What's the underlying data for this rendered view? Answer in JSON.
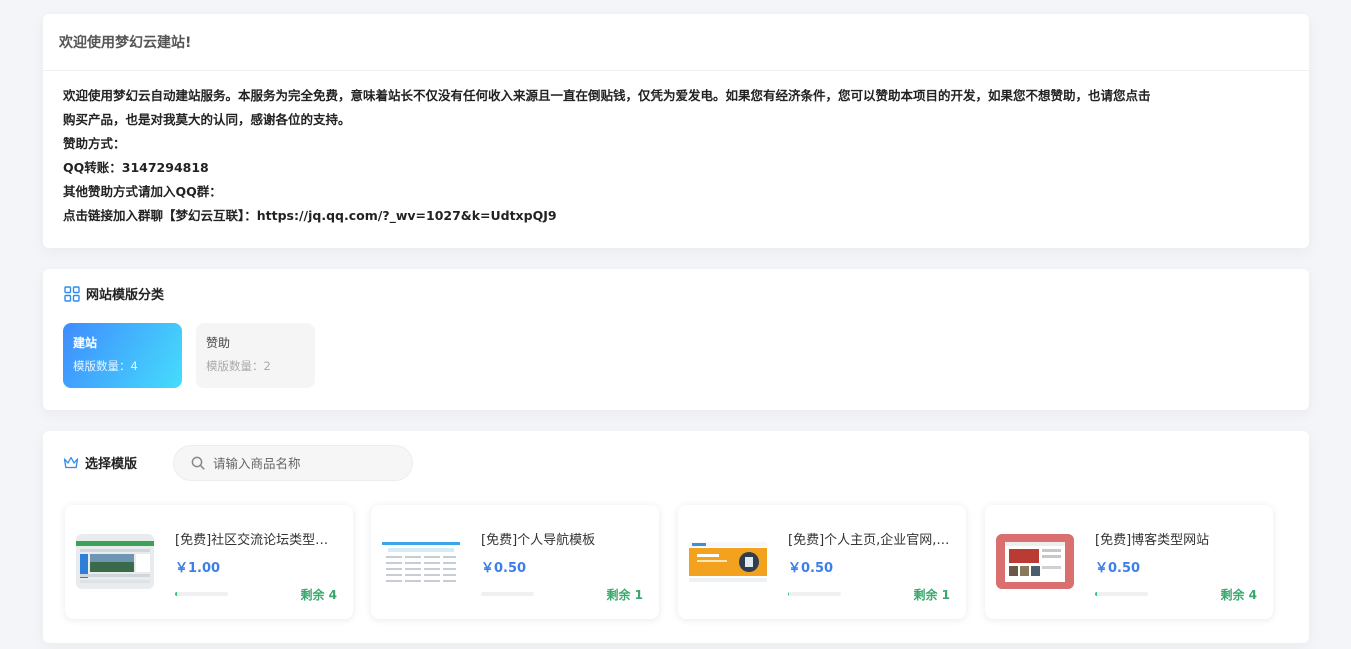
{
  "notice": {
    "title": "欢迎使用梦幻云建站!",
    "lead": "欢迎使用梦幻云自动建站服务。",
    "line1_rest": "本服务为完全免费，意味着站长不仅没有任何收入来源且一直在倒贴钱，仅凭为爱发电。如果您有经济条件，您可以赞助本项目的开发，如果您不想赞助，也请您点击",
    "line2": "购买产品，也是对我莫大的认同，感谢各位的支持。",
    "line3": "赞助方式：",
    "line4": "QQ转账：3147294818",
    "line5": "其他赞助方式请加入QQ群：",
    "line6": "点击链接加入群聊【梦幻云互联】：https://jq.qq.com/?_wv=1027&k=UdtxpQJ9"
  },
  "categories": {
    "title": "网站模版分类",
    "icon": "grid-icon",
    "items": [
      {
        "name": "建站",
        "count_text": "模版数量：4",
        "active": true
      },
      {
        "name": "赞助",
        "count_text": "模版数量：2",
        "active": false
      }
    ]
  },
  "templates": {
    "title": "选择模版",
    "icon": "crown-icon",
    "search": {
      "placeholder": "请输入商品名称",
      "value": ""
    },
    "items": [
      {
        "name": "[免费]社区交流论坛类型网站",
        "price": "￥1.00",
        "stock": "剩余 4",
        "stock_fraction": 0.03,
        "thumb": "forum-thumbnail"
      },
      {
        "name": "[免费]个人导航模板",
        "price": "￥0.50",
        "stock": "剩余 1",
        "stock_fraction": 0.0,
        "thumb": "navigation-thumbnail"
      },
      {
        "name": "[免费]个人主页,企业官网,工作室",
        "price": "￥0.50",
        "stock": "剩余 1",
        "stock_fraction": 0.02,
        "thumb": "homepage-thumbnail"
      },
      {
        "name": "[免费]博客类型网站",
        "price": "￥0.50",
        "stock": "剩余 4",
        "stock_fraction": 0.03,
        "thumb": "blog-thumbnail"
      }
    ]
  },
  "colors": {
    "background": "#f4f5f8",
    "accent_blue": "#3d7fea",
    "active_gradient_start": "#3f8cff",
    "active_gradient_end": "#45ddfb",
    "stock_green": "#3aa76d"
  }
}
